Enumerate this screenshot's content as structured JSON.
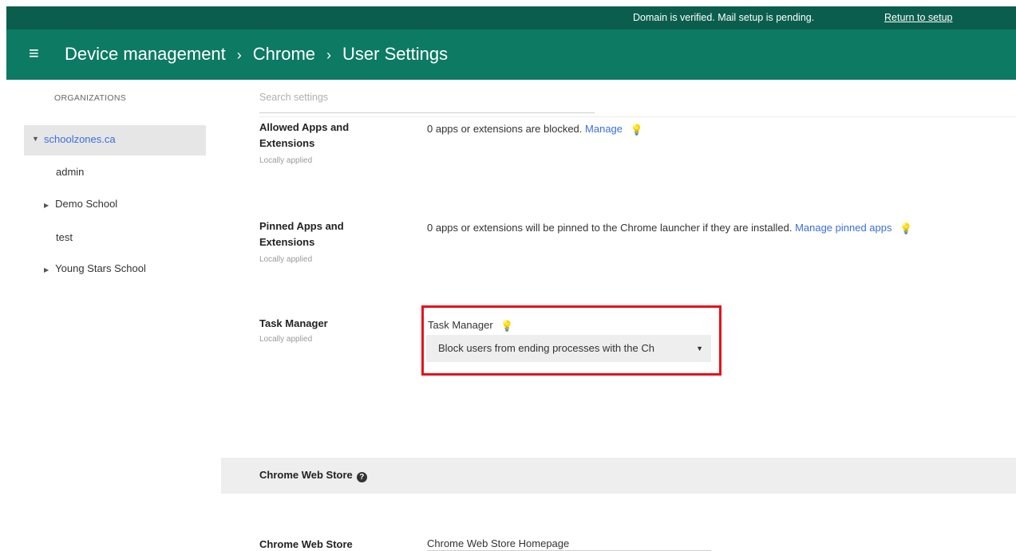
{
  "topbar": {
    "status": "Domain is verified. Mail setup is pending.",
    "return_link": "Return to setup"
  },
  "header": {
    "menu_icon": "≡",
    "crumbs": [
      "Device management",
      "Chrome",
      "User Settings"
    ],
    "separator": "›"
  },
  "sidebar": {
    "title": "ORGANIZATIONS",
    "root": "schoolzones.ca",
    "items": [
      {
        "label": "admin",
        "expandable": false
      },
      {
        "label": "Demo School",
        "expandable": true
      },
      {
        "label": "test",
        "expandable": false
      },
      {
        "label": "Young Stars School",
        "expandable": true
      }
    ]
  },
  "search": {
    "placeholder": "Search settings"
  },
  "settings": [
    {
      "name_line1": "Allowed Apps and",
      "name_line2": "Extensions",
      "sub": "Locally applied",
      "value_text": "0 apps or extensions are blocked.",
      "value_link": "Manage"
    },
    {
      "name_line1": "Pinned Apps and",
      "name_line2": "Extensions",
      "sub": "Locally applied",
      "value_text": "0 apps or extensions will be pinned to the Chrome launcher if they are installed.",
      "value_link": "Manage pinned apps"
    },
    {
      "name_line1": "Task Manager",
      "sub": "Locally applied",
      "field_label": "Task Manager",
      "select_value": "Block users from ending processes with the Ch"
    }
  ],
  "section": {
    "title": "Chrome Web Store"
  },
  "cws": {
    "name": "Chrome Web Store",
    "value": "Chrome Web Store Homepage"
  },
  "colors": {
    "topbar": "#0b5e4d",
    "header": "#0d7a63",
    "link": "#3b6fd6",
    "highlight": "#e8101a"
  }
}
